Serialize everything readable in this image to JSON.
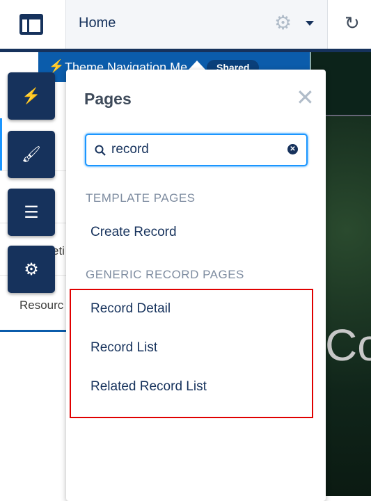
{
  "header": {
    "title": "Home",
    "icons": [
      "layout-icon",
      "gear-icon",
      "chevron-down-icon",
      "refresh-icon"
    ]
  },
  "theme_bar": {
    "label": "Theme Navigation Me",
    "badge": "Shared"
  },
  "left_panel": {
    "partial_labels": [
      "eti",
      "Resourc"
    ]
  },
  "toolbar": {
    "icons": [
      "lightning-icon",
      "brush-icon",
      "list-icon",
      "gear-icon"
    ]
  },
  "hero": {
    "partial_text": "Co"
  },
  "popover": {
    "title": "Pages",
    "search": {
      "value": "record",
      "placeholder": ""
    },
    "sections": [
      {
        "heading": "TEMPLATE PAGES",
        "items": [
          "Create Record"
        ]
      },
      {
        "heading": "GENERIC RECORD PAGES",
        "items": [
          "Record Detail",
          "Record List",
          "Related Record List"
        ]
      }
    ],
    "highlight_color": "#e00000"
  },
  "colors": {
    "navy": "#16325c",
    "blue": "#0b5cab",
    "focus": "#1b96ff"
  }
}
